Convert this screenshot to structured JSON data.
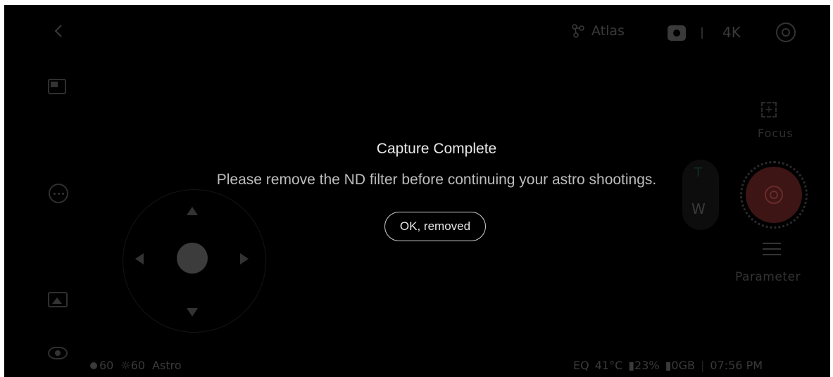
{
  "top_bar": {
    "mode_label": "Atlas",
    "resolution": "4K"
  },
  "right_panel": {
    "focus_label": "Focus",
    "zoom_tele": "T",
    "zoom_wide": "W",
    "parameter_label": "Parameter"
  },
  "status_left": {
    "value_a": "60",
    "value_b": "60",
    "mode": "Astro"
  },
  "status_right": {
    "eq": "EQ",
    "temperature": "41°C",
    "battery": "23%",
    "storage": "0GB",
    "time": "07:56 PM"
  },
  "dialog": {
    "title": "Capture Complete",
    "message": "Please remove the ND filter before continuing your astro shootings.",
    "confirm_label": "OK, removed"
  },
  "colors": {
    "shutter_accent": "#8a2a2a",
    "background": "#000000"
  }
}
